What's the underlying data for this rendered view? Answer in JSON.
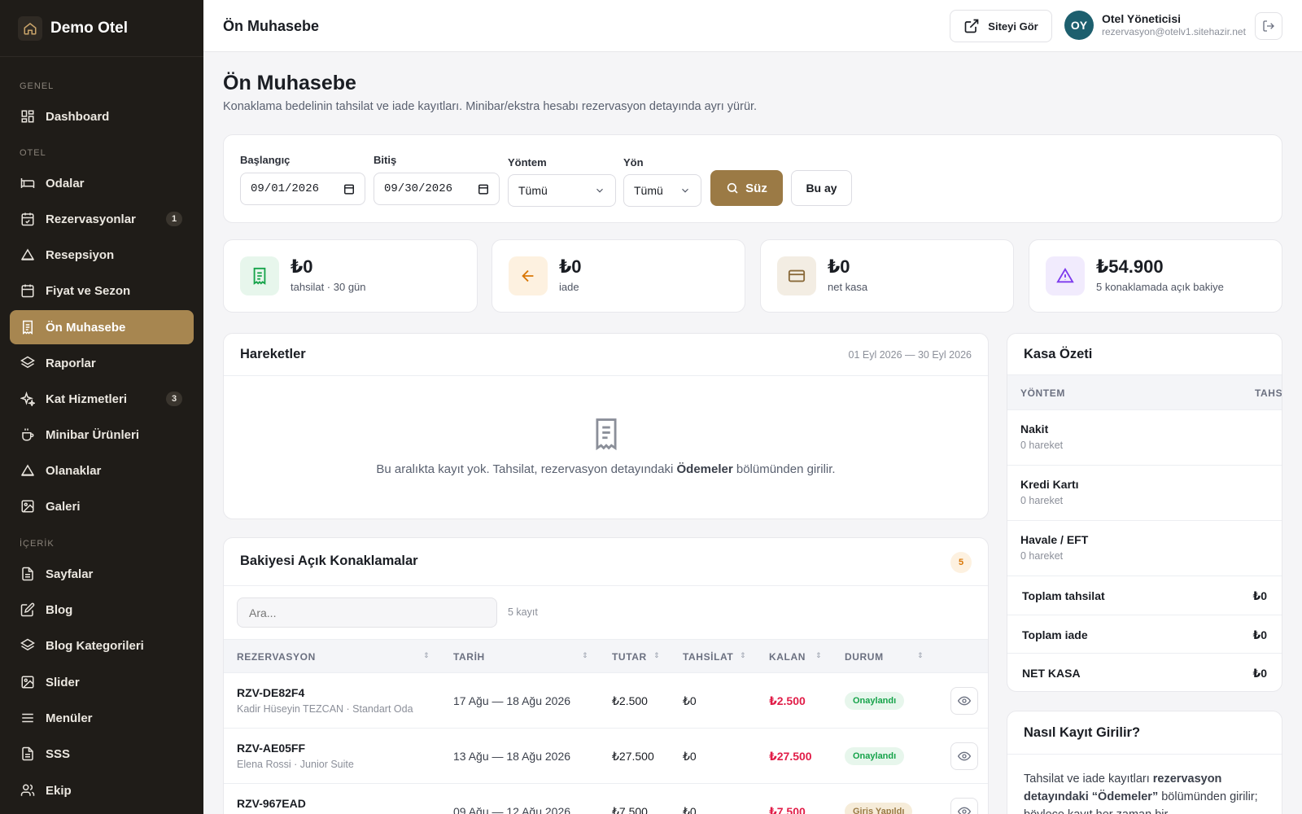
{
  "brand": {
    "name": "Demo Otel"
  },
  "sidebar": {
    "sections": [
      "GENEL",
      "OTEL",
      "İÇERİK"
    ],
    "items": [
      {
        "label": "Dashboard"
      },
      {
        "label": "Odalar"
      },
      {
        "label": "Rezervasyonlar",
        "badge": "1"
      },
      {
        "label": "Resepsiyon"
      },
      {
        "label": "Fiyat ve Sezon"
      },
      {
        "label": "Ön Muhasebe"
      },
      {
        "label": "Raporlar"
      },
      {
        "label": "Kat Hizmetleri",
        "badge": "3"
      },
      {
        "label": "Minibar Ürünleri"
      },
      {
        "label": "Olanaklar"
      },
      {
        "label": "Galeri"
      },
      {
        "label": "Sayfalar"
      },
      {
        "label": "Blog"
      },
      {
        "label": "Blog Kategorileri"
      },
      {
        "label": "Slider"
      },
      {
        "label": "Menüler"
      },
      {
        "label": "SSS"
      },
      {
        "label": "Ekip"
      }
    ]
  },
  "header": {
    "title": "Ön Muhasebe",
    "site_button": "Siteyi Gör",
    "user": {
      "initials": "OY",
      "name": "Otel Yöneticisi",
      "email": "rezervasyon@otelv1.sitehazir.net"
    }
  },
  "page": {
    "title": "Ön Muhasebe",
    "subtitle": "Konaklama bedelinin tahsilat ve iade kayıtları. Minibar/ekstra hesabı rezervasyon detayında ayrı yürür."
  },
  "filters": {
    "start_label": "Başlangıç",
    "start_value": "09/01/2026",
    "end_label": "Bitiş",
    "end_value": "09/30/2026",
    "method_label": "Yöntem",
    "method_value": "Tümü",
    "direction_label": "Yön",
    "direction_value": "Tümü",
    "filter_button": "Süz",
    "month_button": "Bu ay"
  },
  "stats": [
    {
      "value": "₺0",
      "label": "tahsilat · 30 gün",
      "color": "#16a34a"
    },
    {
      "value": "₺0",
      "label": "iade",
      "color": "#d97706"
    },
    {
      "value": "₺0",
      "label": "net kasa",
      "color": "#8a6a3a"
    },
    {
      "value": "₺54.900",
      "label": "5 konaklamada açık bakiye",
      "color": "#7c3aed"
    }
  ],
  "movements": {
    "title": "Hareketler",
    "range": "01 Eyl 2026 — 30 Eyl 2026",
    "empty_pre": "Bu aralıkta kayıt yok. Tahsilat, rezervasyon detayındaki ",
    "empty_strong": "Ödemeler",
    "empty_post": " bölümünden girilir."
  },
  "open_balances": {
    "title": "Bakiyesi Açık Konaklamalar",
    "count_badge": "5",
    "search_placeholder": "Ara...",
    "record_count": "5 kayıt",
    "columns": [
      "REZERVASYON",
      "TARİH",
      "TUTAR",
      "TAHSİLAT",
      "KALAN",
      "DURUM"
    ],
    "rows": [
      {
        "code": "RZV-DE82F4",
        "guest": "Kadir Hüseyin TEZCAN · Standart Oda",
        "date": "17 Ağu — 18 Ağu 2026",
        "amount": "₺2.500",
        "paid": "₺0",
        "remaining": "₺2.500",
        "status": "Onaylandı"
      },
      {
        "code": "RZV-AE05FF",
        "guest": "Elena Rossi · Junior Suite",
        "date": "13 Ağu — 18 Ağu 2026",
        "amount": "₺27.500",
        "paid": "₺0",
        "remaining": "₺27.500",
        "status": "Onaylandı"
      },
      {
        "code": "RZV-967EAD",
        "guest": "",
        "date": "09 Ağu — 12 Ağu 2026",
        "amount": "₺7.500",
        "paid": "₺0",
        "remaining": "₺7.500",
        "status": "Giriş Yapıldı"
      }
    ]
  },
  "cash_summary": {
    "title": "Kasa Özeti",
    "col_method": "YÖNTEM",
    "col_collection": "TAHS",
    "methods": [
      {
        "name": "Nakit",
        "count": "0 hareket"
      },
      {
        "name": "Kredi Kartı",
        "count": "0 hareket"
      },
      {
        "name": "Havale / EFT",
        "count": "0 hareket"
      }
    ],
    "totals": [
      {
        "label": "Toplam tahsilat",
        "value": "₺0"
      },
      {
        "label": "Toplam iade",
        "value": "₺0"
      },
      {
        "label": "NET KASA",
        "value": "₺0"
      }
    ]
  },
  "howto": {
    "title": "Nasıl Kayıt Girilir?",
    "text_pre": "Tahsilat ve iade kayıtları ",
    "text_strong": "rezervasyon detayındaki “Ödemeler”",
    "text_post": " bölümünden girilir; böylece kayıt her zaman bir"
  }
}
